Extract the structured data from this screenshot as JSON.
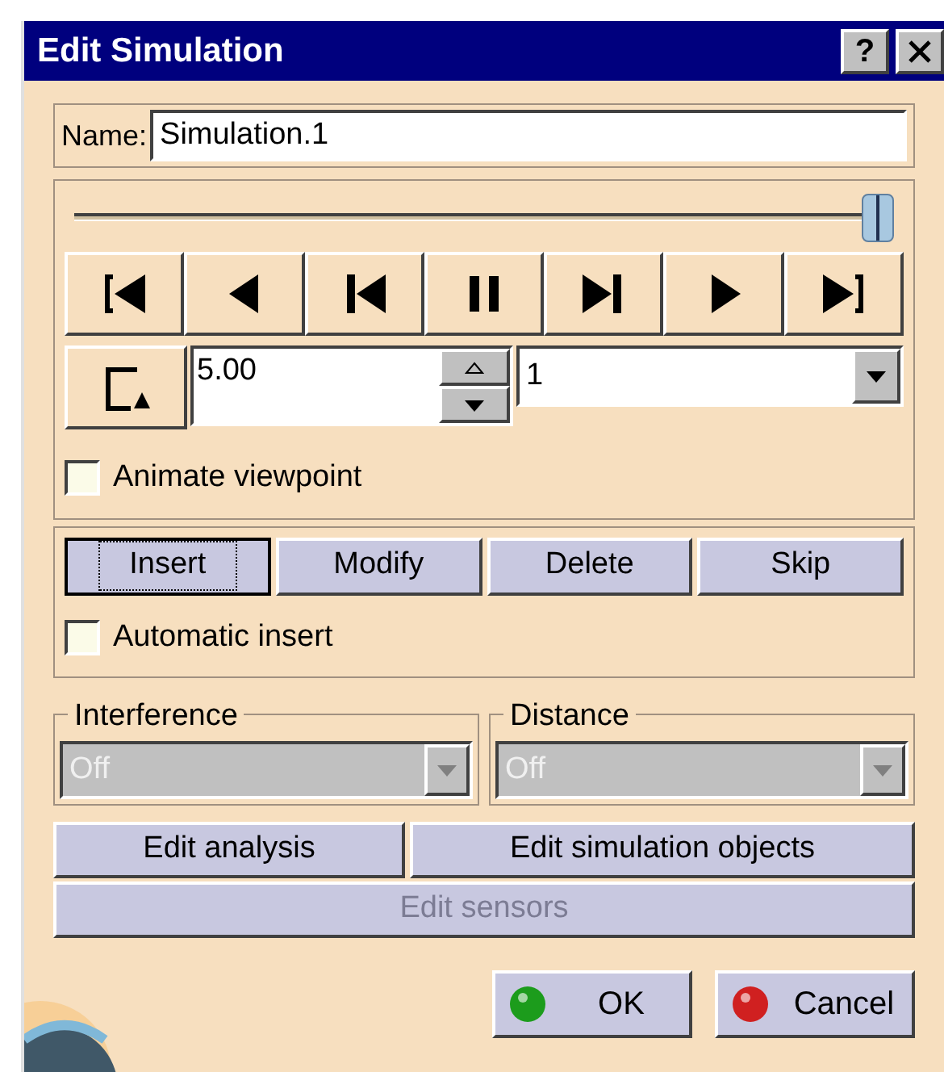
{
  "window": {
    "title": "Edit Simulation",
    "help": "?"
  },
  "name": {
    "label": "Name:",
    "value": "Simulation.1"
  },
  "slider": {
    "level": 1
  },
  "transport": [
    {
      "kind": "first"
    },
    {
      "kind": "back"
    },
    {
      "kind": "step-back"
    },
    {
      "kind": "pause"
    },
    {
      "kind": "step-forward"
    },
    {
      "kind": "play"
    },
    {
      "kind": "last"
    }
  ],
  "step": {
    "value": "5.00",
    "dropdown_value": "1"
  },
  "animate_viewpoint": {
    "label": "Animate viewpoint",
    "checked": false
  },
  "record_buttons": [
    {
      "label": "Insert",
      "focused": true
    },
    {
      "label": "Modify",
      "focused": false
    },
    {
      "label": "Delete",
      "focused": false
    },
    {
      "label": "Skip",
      "focused": false
    }
  ],
  "automatic_insert": {
    "label": "Automatic insert",
    "checked": false
  },
  "groups": [
    {
      "title": "Interference",
      "value": "Off",
      "disabled": true
    },
    {
      "title": "Distance",
      "value": "Off",
      "disabled": true
    }
  ],
  "edit_buttons": [
    {
      "label": "Edit analysis",
      "disabled": false
    },
    {
      "label": "Edit simulation objects",
      "disabled": false
    },
    {
      "label": "Edit sensors",
      "disabled": true
    }
  ],
  "dialog_buttons": [
    {
      "label": "OK",
      "color": "#1c9c1c"
    },
    {
      "label": "Cancel",
      "color": "#d02020"
    }
  ]
}
